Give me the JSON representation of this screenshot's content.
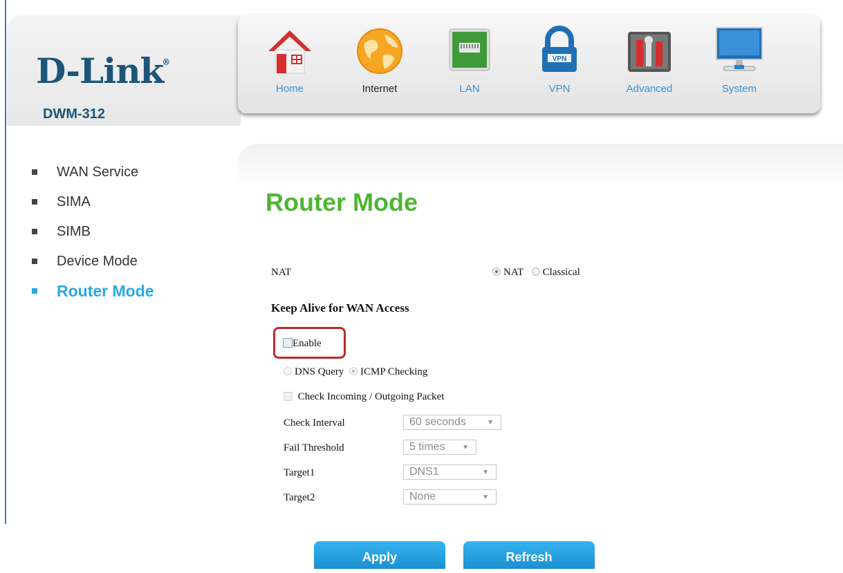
{
  "brand": {
    "logo": "D-Link",
    "registered": "®",
    "model": "DWM-312"
  },
  "nav": [
    {
      "label": "Home",
      "icon": "home-icon"
    },
    {
      "label": "Internet",
      "icon": "globe-icon",
      "active": true
    },
    {
      "label": "LAN",
      "icon": "lan-port-icon"
    },
    {
      "label": "VPN",
      "icon": "vpn-lock-icon"
    },
    {
      "label": "Advanced",
      "icon": "tools-icon"
    },
    {
      "label": "System",
      "icon": "monitor-icon"
    }
  ],
  "sidebar": {
    "items": [
      {
        "label": "WAN Service"
      },
      {
        "label": "SIMA"
      },
      {
        "label": "SIMB"
      },
      {
        "label": "Device Mode"
      },
      {
        "label": "Router Mode",
        "active": true
      }
    ]
  },
  "page": {
    "title": "Router Mode",
    "nat": {
      "label": "NAT",
      "options": [
        "NAT",
        "Classical"
      ],
      "selected": "NAT"
    },
    "keepalive": {
      "heading": "Keep Alive for WAN Access",
      "enable_label": "Enable",
      "enable_checked": false,
      "method_options": [
        "DNS Query",
        "ICMP Checking"
      ],
      "method_selected": "ICMP Checking",
      "check_packet_label": "Check Incoming / Outgoing Packet",
      "check_interval": {
        "label": "Check Interval",
        "value": "60 seconds"
      },
      "fail_threshold": {
        "label": "Fail Threshold",
        "value": "5 times"
      },
      "target1": {
        "label": "Target1",
        "value": "DNS1"
      },
      "target2": {
        "label": "Target2",
        "value": "None"
      }
    }
  },
  "buttons": {
    "apply": "Apply",
    "refresh": "Refresh"
  },
  "colors": {
    "brand_blue": "#1c5577",
    "accent_blue": "#29a9e0",
    "title_green": "#4fb433",
    "highlight_red": "#c0272d",
    "button_blue": "#1b8fd2"
  }
}
